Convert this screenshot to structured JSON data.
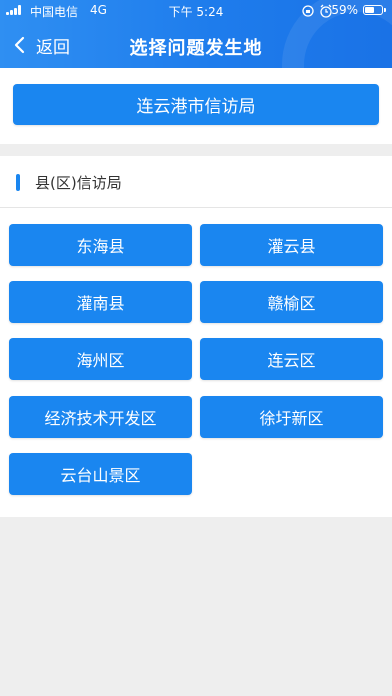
{
  "status_bar": {
    "carrier": "中国电信",
    "network": "4G",
    "time": "下午 5:24",
    "battery": "59%",
    "battery_level": 0.59
  },
  "header": {
    "back_label": "返回",
    "title": "选择问题发生地"
  },
  "city_button": "连云港市信访局",
  "county_section": {
    "title": "县(区)信访局",
    "items": [
      "东海县",
      "灌云县",
      "灌南县",
      "赣榆区",
      "海州区",
      "连云区",
      "经济技术开发区",
      "徐圩新区",
      "云台山景区"
    ]
  },
  "colors": {
    "header": "#1e7cec",
    "button": "#1a86f0",
    "background": "#eeeeee"
  }
}
